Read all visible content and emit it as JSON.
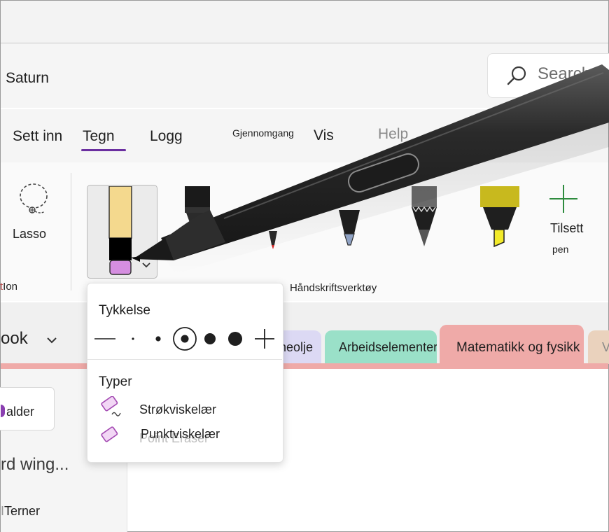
{
  "app": {
    "title": "Saturn"
  },
  "search": {
    "placeholder": "Search"
  },
  "tabs": [
    {
      "label": "Sett inn"
    },
    {
      "label": "Tegn"
    },
    {
      "label": "Logg"
    },
    {
      "label": "Gjennomgang"
    },
    {
      "label": "Vis"
    },
    {
      "label": "Help"
    }
  ],
  "active_tab": "Tegn",
  "ribbon": {
    "lasso_label": "Lasso",
    "group1_label_partial": "Ion",
    "group_handwriting_label": "Håndskriftsverktøy",
    "add_pen_label": "Tilsett",
    "add_pen_sublabel": "pen",
    "pens": [
      {
        "kind": "eraser",
        "selected": true,
        "color": "#d58ee0"
      },
      {
        "kind": "pen",
        "color": "#1a1a1a"
      },
      {
        "kind": "pen",
        "color": "#d12525"
      },
      {
        "kind": "pen",
        "color": "#8fa2c4"
      },
      {
        "kind": "pencil",
        "color": "#6a6a6a"
      },
      {
        "kind": "highlighter",
        "color": "#f2ea2a"
      }
    ]
  },
  "notebook": {
    "name": "ook"
  },
  "sections": [
    {
      "label": "neolje",
      "color": "#dcd9f4"
    },
    {
      "label": "Arbeidselementer",
      "color": "#9ae0c8"
    },
    {
      "label": "Matematikk og fysikk",
      "color": "#efaaa8"
    },
    {
      "label": "V",
      "color": "#ead2bd"
    }
  ],
  "left_pane": {
    "folder_label": "alder",
    "pages": [
      {
        "label": "rd wing..."
      },
      {
        "label": "Terner"
      }
    ]
  },
  "eraser_popup": {
    "thickness_heading": "Tykkelse",
    "thickness_options": [
      "thinnest",
      "extra-thin",
      "thin",
      "medium",
      "thick",
      "extra-thick",
      "add"
    ],
    "selected_thickness": "medium",
    "types_heading": "Typer",
    "types": [
      {
        "label": "Strøkviskelær"
      },
      {
        "label": "Punktviskelær"
      }
    ],
    "ghost_text": "Point Eraser"
  },
  "colors": {
    "accent": "#6b2fa0",
    "eraser_purple": "#a349b2",
    "section_stripe": "#efaaa8"
  }
}
